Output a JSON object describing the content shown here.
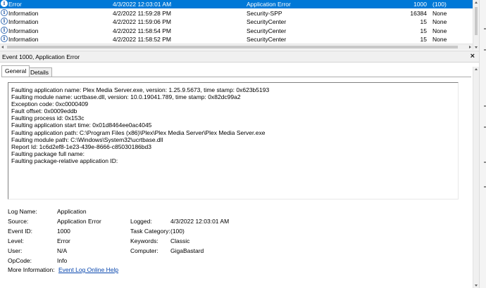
{
  "events": [
    {
      "level": "Error",
      "date": "4/3/2022 12:03:01 AM",
      "source": "Application Error",
      "id": "1000",
      "task": "(100)",
      "selected": true
    },
    {
      "level": "Information",
      "date": "4/2/2022 11:59:28 PM",
      "source": "Security-SPP",
      "id": "16384",
      "task": "None",
      "selected": false
    },
    {
      "level": "Information",
      "date": "4/2/2022 11:59:06 PM",
      "source": "SecurityCenter",
      "id": "15",
      "task": "None",
      "selected": false
    },
    {
      "level": "Information",
      "date": "4/2/2022 11:58:54 PM",
      "source": "SecurityCenter",
      "id": "15",
      "task": "None",
      "selected": false
    },
    {
      "level": "Information",
      "date": "4/2/2022 11:58:52 PM",
      "source": "SecurityCenter",
      "id": "15",
      "task": "None",
      "selected": false
    }
  ],
  "detail": {
    "title": "Event 1000, Application Error",
    "close_glyph": "×",
    "tabs": [
      "General",
      "Details"
    ],
    "description": [
      "Faulting application name: Plex Media Server.exe, version: 1.25.9.5673, time stamp: 0x623b5193",
      "Faulting module name: ucrtbase.dll, version: 10.0.19041.789, time stamp: 0x82dc99a2",
      "Exception code: 0xc0000409",
      "Fault offset: 0x0009eddb",
      "Faulting process id: 0x153c",
      "Faulting application start time: 0x01d8464ee0ac4045",
      "Faulting application path: C:\\Program Files (x86)\\Plex\\Plex Media Server\\Plex Media Server.exe",
      "Faulting module path: C:\\Windows\\System32\\ucrtbase.dll",
      "Report Id: 1c6d2ef8-1e23-439e-8666-c85030186bd3",
      "Faulting package full name:",
      "Faulting package-relative application ID:"
    ],
    "properties": {
      "log_name_label": "Log Name:",
      "log_name": "Application",
      "source_label": "Source:",
      "source": "Application Error",
      "logged_label": "Logged:",
      "logged": "4/3/2022 12:03:01 AM",
      "event_id_label": "Event ID:",
      "event_id": "1000",
      "task_category_label": "Task Category:",
      "task_category": "(100)",
      "level_label": "Level:",
      "level": "Error",
      "keywords_label": "Keywords:",
      "keywords": "Classic",
      "user_label": "User:",
      "user": "N/A",
      "computer_label": "Computer:",
      "computer": "GigaBastard",
      "opcode_label": "OpCode:",
      "opcode": "Info",
      "more_info_label": "More Information:",
      "more_info_link": "Event Log Online Help"
    }
  },
  "icons": {
    "info": "i"
  },
  "colors": {
    "selection": "#0078d7",
    "link": "#0645ad"
  }
}
